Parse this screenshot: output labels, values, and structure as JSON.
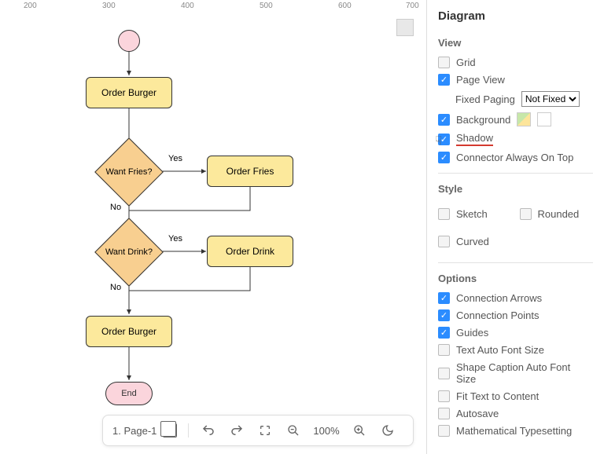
{
  "ruler": {
    "ticks": [
      "200",
      "300",
      "400",
      "500",
      "600",
      "700"
    ]
  },
  "flow": {
    "orderBurger1": "Order Burger",
    "wantFries": "Want Fries?",
    "orderFries": "Order Fries",
    "wantDrink": "Want Drink?",
    "orderDrink": "Order Drink",
    "orderBurger2": "Order Burger",
    "end": "End",
    "yes1": "Yes",
    "no1": "No",
    "yes2": "Yes",
    "no2": "No"
  },
  "bottombar": {
    "pageLabel": "1. Page-1",
    "zoom": "100%"
  },
  "sidebar": {
    "title": "Diagram",
    "sections": {
      "view": "View",
      "style": "Style",
      "options": "Options"
    },
    "view": {
      "grid": "Grid",
      "pageView": "Page View",
      "fixedPaging": "Fixed Paging",
      "fixedPagingValue": "Not Fixed",
      "background": "Background",
      "shadow": "Shadow",
      "connectorTop": "Connector Always On Top"
    },
    "style": {
      "sketch": "Sketch",
      "rounded": "Rounded",
      "curved": "Curved"
    },
    "options": {
      "connectionArrows": "Connection Arrows",
      "connectionPoints": "Connection Points",
      "guides": "Guides",
      "textAutoFont": "Text Auto Font Size",
      "shapeCaptionAuto": "Shape Caption Auto Font Size",
      "fitText": "Fit Text to Content",
      "autosave": "Autosave",
      "mathType": "Mathematical Typesetting"
    }
  }
}
